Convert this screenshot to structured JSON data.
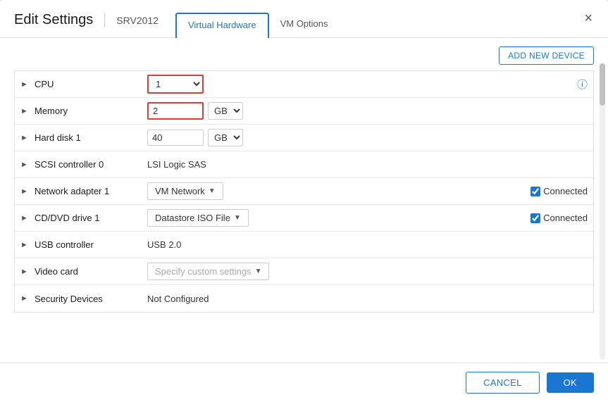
{
  "dialog": {
    "title": "Edit Settings",
    "subtitle": "SRV2012",
    "close_label": "×"
  },
  "tabs": [
    {
      "id": "virtual-hardware",
      "label": "Virtual Hardware",
      "active": true
    },
    {
      "id": "vm-options",
      "label": "VM Options",
      "active": false
    }
  ],
  "toolbar": {
    "add_device_label": "ADD NEW DEVICE"
  },
  "rows": [
    {
      "id": "cpu",
      "label": "CPU",
      "type": "cpu-select",
      "value": "1",
      "has_info": true
    },
    {
      "id": "memory",
      "label": "Memory",
      "type": "memory-input",
      "value": "2",
      "unit": "GB"
    },
    {
      "id": "hard-disk",
      "label": "Hard disk 1",
      "type": "disk-input",
      "value": "40",
      "unit": "GB"
    },
    {
      "id": "scsi",
      "label": "SCSI controller 0",
      "type": "text",
      "value": "LSI Logic SAS"
    },
    {
      "id": "network",
      "label": "Network adapter 1",
      "type": "network-dropdown",
      "value": "VM Network",
      "connected": true
    },
    {
      "id": "cddvd",
      "label": "CD/DVD drive 1",
      "type": "cddvd-dropdown",
      "value": "Datastore ISO File",
      "connected": true
    },
    {
      "id": "usb",
      "label": "USB controller",
      "type": "text",
      "value": "USB 2.0"
    },
    {
      "id": "video",
      "label": "Video card",
      "type": "specify-dropdown",
      "value": "Specify custom settings"
    },
    {
      "id": "security",
      "label": "Security Devices",
      "type": "text",
      "value": "Not Configured"
    }
  ],
  "footer": {
    "cancel_label": "CANCEL",
    "ok_label": "OK"
  },
  "connected_label": "Connected"
}
